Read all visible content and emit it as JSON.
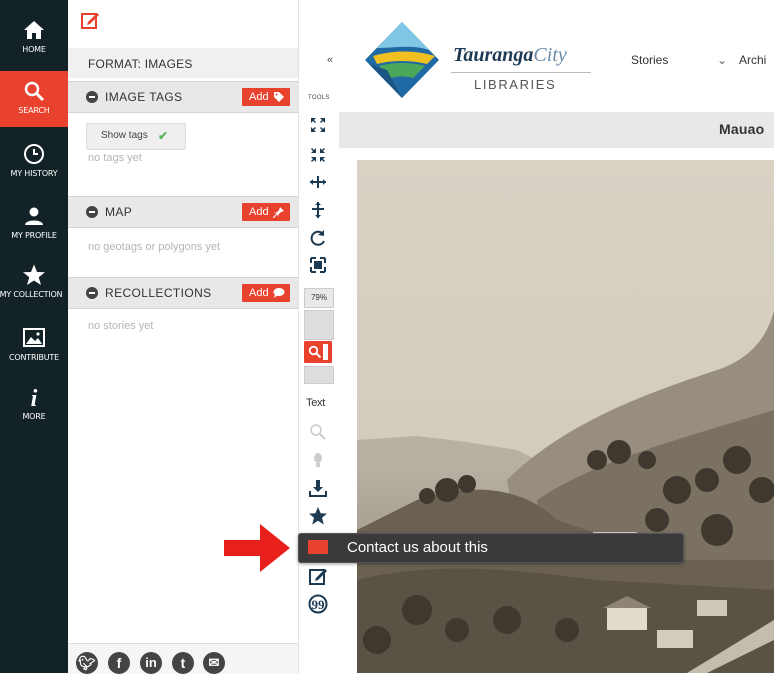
{
  "nav": {
    "items": [
      {
        "label": "HOME",
        "icon": "home-icon"
      },
      {
        "label": "SEARCH",
        "icon": "search-icon"
      },
      {
        "label": "MY HISTORY",
        "icon": "clock-icon"
      },
      {
        "label": "MY PROFILE",
        "icon": "user-icon"
      },
      {
        "label": "MY COLLECTION",
        "icon": "star-icon"
      },
      {
        "label": "CONTRIBUTE",
        "icon": "image-icon"
      },
      {
        "label": "MORE",
        "icon": "info-icon"
      }
    ],
    "active_color": "#e8412e"
  },
  "panel": {
    "format": "FORMAT: IMAGES",
    "sections": {
      "tags": {
        "title": "IMAGE TAGS",
        "add": "Add",
        "show_tags": "Show tags",
        "empty": "no tags yet"
      },
      "map": {
        "title": "MAP",
        "add": "Add",
        "empty": "no geotags or polygons yet"
      },
      "recollections": {
        "title": "RECOLLECTIONS",
        "add": "Add",
        "empty": "no stories yet"
      }
    },
    "social": [
      "twitter-icon",
      "facebook-icon",
      "linkedin-icon",
      "tumblr-icon",
      "email-icon"
    ]
  },
  "tools": {
    "label": "TOOLS",
    "zoom": "79%",
    "text": "Text"
  },
  "header": {
    "brand_name": "Tauranga",
    "brand_city": "City",
    "brand_sub": "LIBRARIES",
    "nav": [
      "Stories",
      "Archi"
    ]
  },
  "title": "Mauao",
  "tooltip": "Contact us about this"
}
